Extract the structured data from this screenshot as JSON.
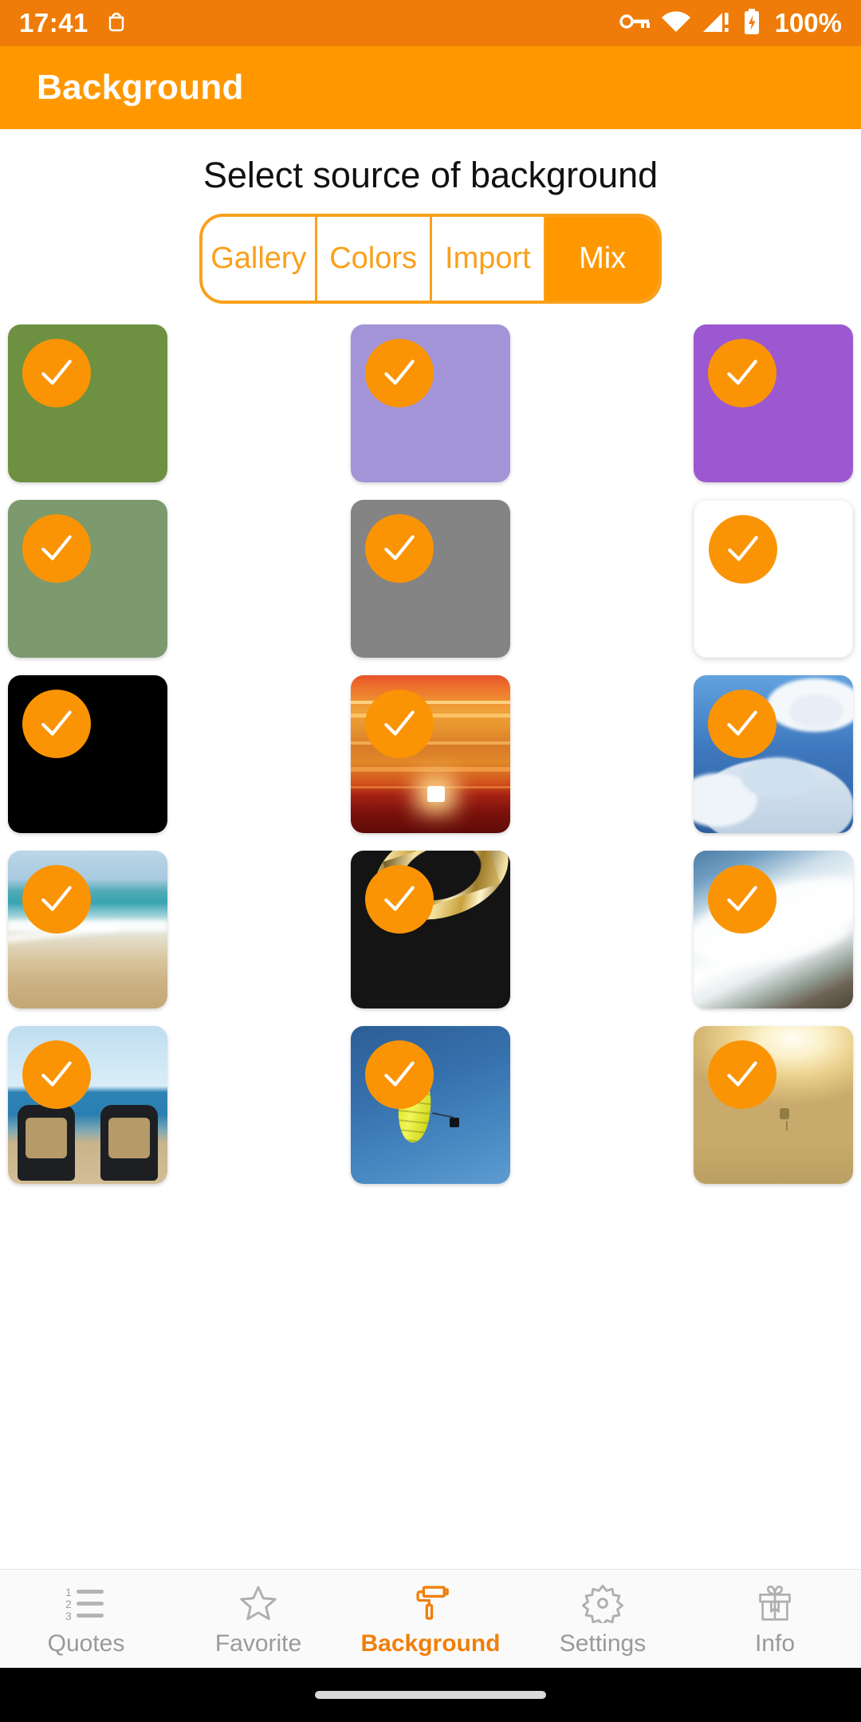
{
  "status_bar": {
    "time": "17:41",
    "battery_percent": "100%",
    "icons": [
      "debug-android-icon",
      "vpn-key-icon",
      "wifi-icon",
      "cellular-signal-warning-icon",
      "battery-charging-icon"
    ],
    "background_color": "#EF7C08"
  },
  "app_bar": {
    "title": "Background",
    "background_color": "#FF9800",
    "title_color": "#FFFFFF"
  },
  "main": {
    "section_title": "Select source of background",
    "accent_color": "#F9A01B",
    "tabs": [
      {
        "label": "Gallery",
        "active": false
      },
      {
        "label": "Colors",
        "active": false
      },
      {
        "label": "Import",
        "active": false
      },
      {
        "label": "Mix",
        "active": true
      }
    ],
    "tiles": [
      {
        "name": "olive-green-color",
        "kind": "color",
        "color": "#6E9141",
        "selected": true
      },
      {
        "name": "light-purple-color",
        "kind": "color",
        "color": "#A294D6",
        "selected": true
      },
      {
        "name": "vivid-purple-color",
        "kind": "color",
        "color": "#9B58D1",
        "selected": true
      },
      {
        "name": "sage-green-color",
        "kind": "color",
        "color": "#7C9A6D",
        "selected": true
      },
      {
        "name": "gray-color",
        "kind": "color",
        "color": "#848484",
        "selected": true
      },
      {
        "name": "white-color",
        "kind": "color",
        "color": "#FFFFFF",
        "selected": true
      },
      {
        "name": "black-color",
        "kind": "color",
        "color": "#000000",
        "selected": true
      },
      {
        "name": "sunset-over-sea-photo",
        "kind": "photo",
        "selected": true
      },
      {
        "name": "blue-sky-clouds-photo",
        "kind": "photo",
        "selected": true
      },
      {
        "name": "beach-sand-shore-photo",
        "kind": "photo",
        "selected": true
      },
      {
        "name": "gold-ring-photo",
        "kind": "photo",
        "selected": true
      },
      {
        "name": "ocean-surf-waves-photo",
        "kind": "photo",
        "selected": true
      },
      {
        "name": "beach-chairs-photo",
        "kind": "photo",
        "selected": true
      },
      {
        "name": "yellow-paraglider-photo",
        "kind": "photo",
        "selected": true
      },
      {
        "name": "golden-sunset-haze-photo",
        "kind": "photo",
        "selected": true
      }
    ]
  },
  "bottom_nav": {
    "active_color": "#F07F0A",
    "inactive_color": "#9A9A9A",
    "items": [
      {
        "label": "Quotes",
        "icon": "numbered-list-icon",
        "active": false
      },
      {
        "label": "Favorite",
        "icon": "star-icon",
        "active": false
      },
      {
        "label": "Background",
        "icon": "paint-roller-icon",
        "active": true
      },
      {
        "label": "Settings",
        "icon": "gear-icon",
        "active": false
      },
      {
        "label": "Info",
        "icon": "gift-icon",
        "active": false
      }
    ]
  }
}
